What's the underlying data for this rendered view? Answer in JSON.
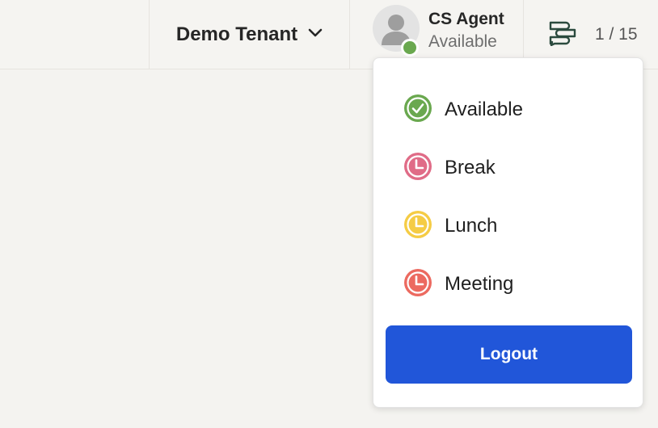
{
  "header": {
    "tenant_name": "Demo Tenant",
    "agent": {
      "name": "CS Agent",
      "status": "Available",
      "status_color": "#6aa84f"
    },
    "conversations": {
      "icon": "conversations-icon",
      "count": "1 / 15"
    }
  },
  "status_menu": {
    "items": [
      {
        "label": "Available",
        "icon": "check-circle-icon",
        "color": "#6aa84f"
      },
      {
        "label": "Break",
        "icon": "clock-icon",
        "color": "#e06c87"
      },
      {
        "label": "Lunch",
        "icon": "clock-icon",
        "color": "#f5cc45"
      },
      {
        "label": "Meeting",
        "icon": "clock-icon",
        "color": "#ec6a60"
      }
    ],
    "logout_label": "Logout"
  },
  "colors": {
    "primary": "#2156d9",
    "background": "#f4f3f0"
  }
}
